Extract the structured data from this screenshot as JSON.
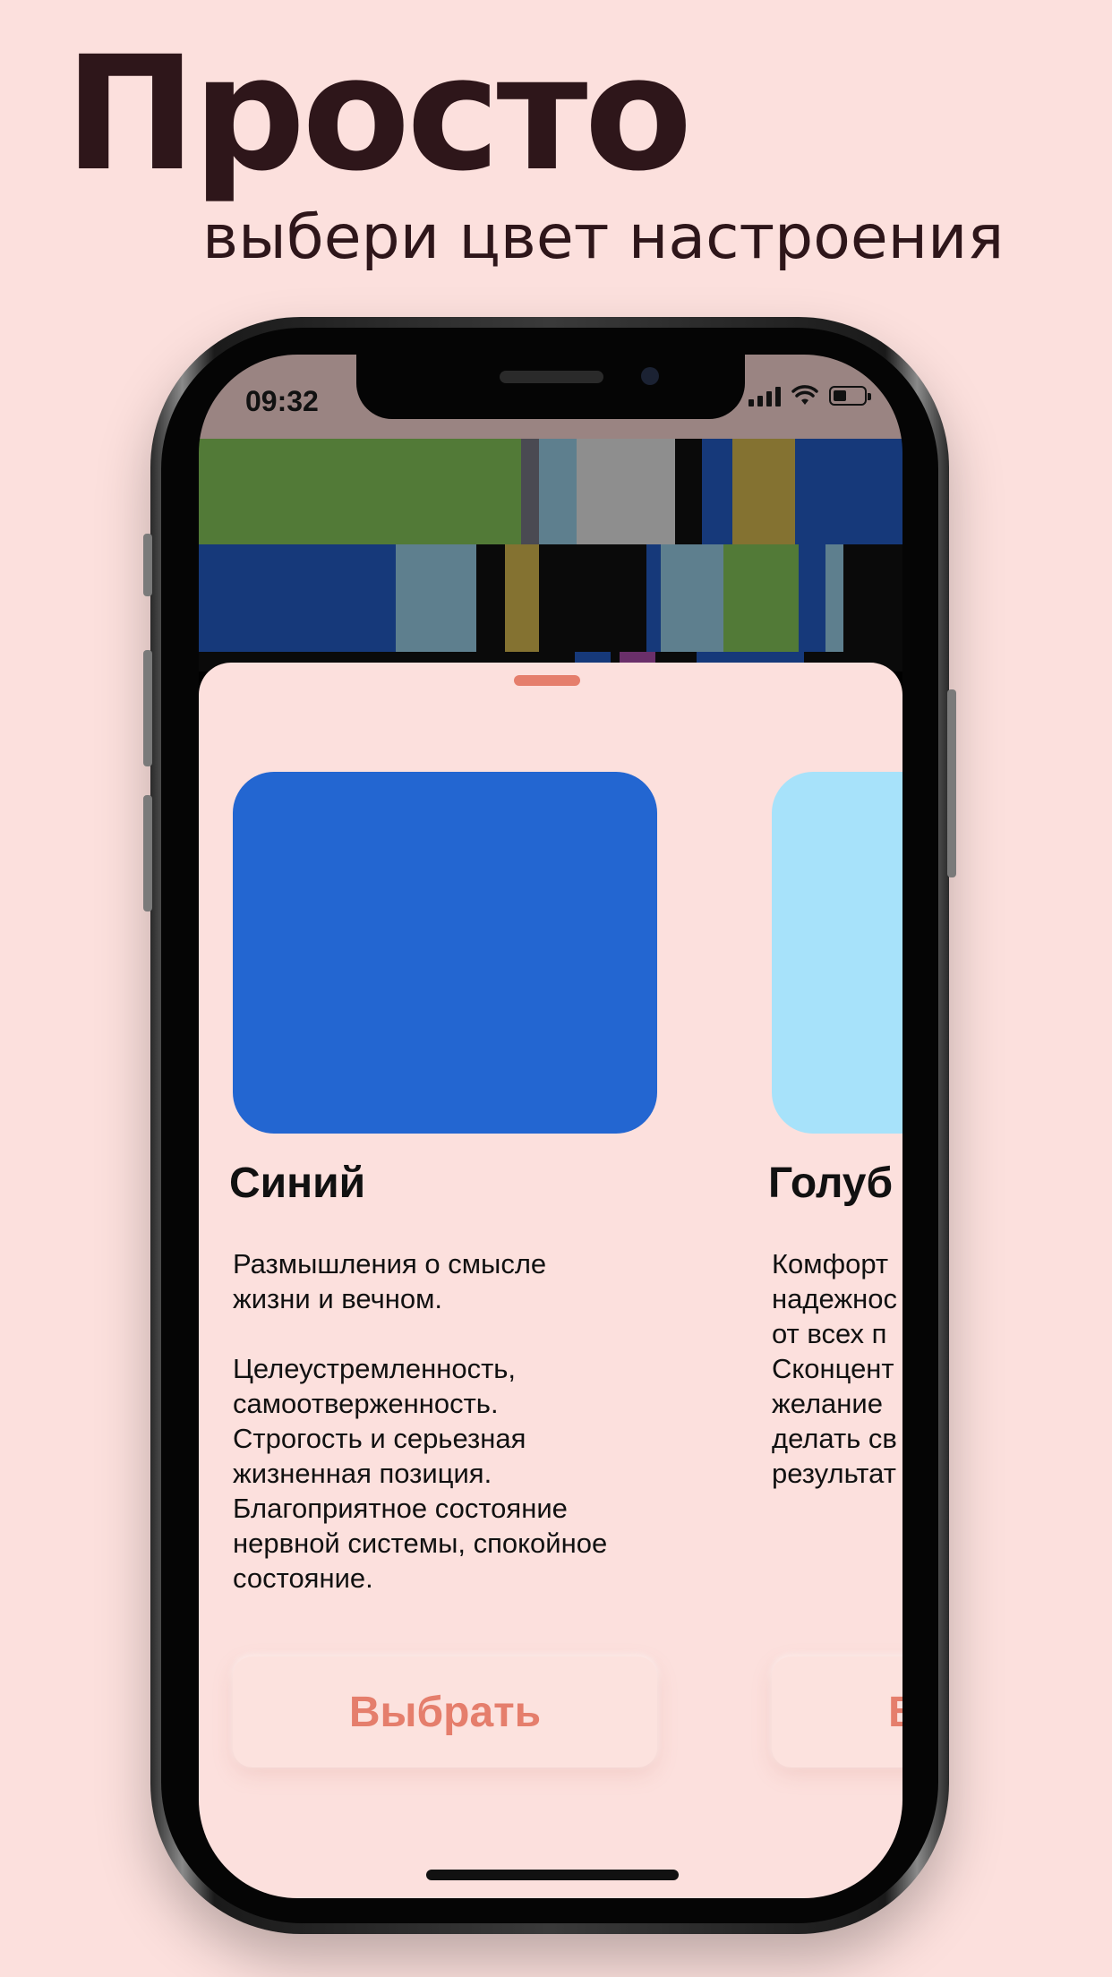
{
  "promo": {
    "headline": "Просто",
    "subline": "выбери цвет настроения"
  },
  "status_bar": {
    "time": "09:32",
    "icons": [
      "cellular-signal-icon",
      "wifi-icon",
      "battery-icon"
    ]
  },
  "cards": [
    {
      "title": "Синий",
      "color": "#2366d1",
      "description": "Размышления о смысле\nжизни и вечном.\n\nЦелеустремленность,\nсамоотверженность.\nСтрогость и серьезная\nжизненная позиция.\nБлагоприятное состояние\nнервной системы, спокойное\nсостояние.",
      "button": "Выбрать"
    },
    {
      "title": "Голуб",
      "color": "#a7e2fa",
      "description": "Комфорт\nнадежнос\nот всех п\nСконцент\nжелание\nделать св\nрезультат",
      "button": "В"
    }
  ],
  "mosaic_colors": [
    "#527a37",
    "#4a4a52",
    "#5e7f8e",
    "#8e8e8e",
    "#0a0a0a",
    "#16397a",
    "#847231",
    "#16397a",
    "#5e7f8e",
    "#6a2f6a"
  ]
}
